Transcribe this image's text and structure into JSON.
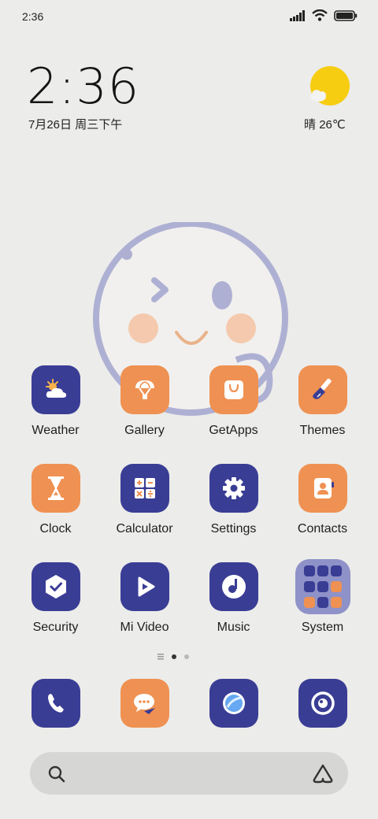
{
  "status_bar": {
    "time": "2:36",
    "icons": [
      "signal-icon",
      "wifi-icon",
      "battery-icon"
    ]
  },
  "clock_widget": {
    "time": "2:36",
    "date": "7月26日 周三下午"
  },
  "weather_widget": {
    "condition": "晴",
    "temperature": "26℃",
    "icon": "sun-cloud-icon"
  },
  "apps": [
    {
      "label": "Weather",
      "icon": "weather-icon",
      "color": "#3a3d94"
    },
    {
      "label": "Gallery",
      "icon": "gallery-icon",
      "color": "#ef9152"
    },
    {
      "label": "GetApps",
      "icon": "getapps-icon",
      "color": "#ef9152"
    },
    {
      "label": "Themes",
      "icon": "themes-icon",
      "color": "#ef9152"
    },
    {
      "label": "Clock",
      "icon": "clock-icon",
      "color": "#ef9152"
    },
    {
      "label": "Calculator",
      "icon": "calculator-icon",
      "color": "#3a3d94"
    },
    {
      "label": "Settings",
      "icon": "settings-icon",
      "color": "#3a3d94"
    },
    {
      "label": "Contacts",
      "icon": "contacts-icon",
      "color": "#ef9152"
    },
    {
      "label": "Security",
      "icon": "security-icon",
      "color": "#3a3d94"
    },
    {
      "label": "Mi Video",
      "icon": "video-icon",
      "color": "#3a3d94"
    },
    {
      "label": "Music",
      "icon": "music-icon",
      "color": "#3a3d94"
    },
    {
      "label": "System",
      "icon": "folder-icon",
      "color": "#8e92c8"
    }
  ],
  "pager": {
    "pages": 2,
    "active": 1
  },
  "dock": [
    {
      "icon": "phone-icon",
      "color": "#3a3d94"
    },
    {
      "icon": "messages-icon",
      "color": "#ef9152"
    },
    {
      "icon": "browser-icon",
      "color": "#3a3d94"
    },
    {
      "icon": "camera-icon",
      "color": "#3a3d94"
    }
  ],
  "search_bar": {
    "icon": "search-icon",
    "assistant_icon": "assistant-icon"
  }
}
